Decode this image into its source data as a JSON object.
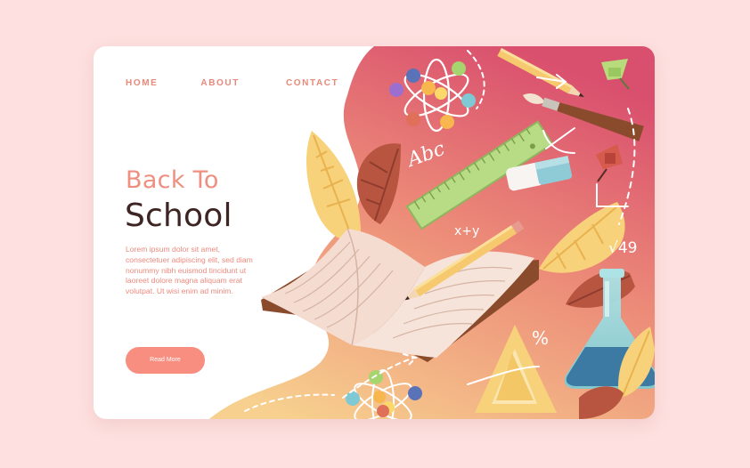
{
  "nav": {
    "home": "HOME",
    "about": "ABOUT",
    "contact": "CONTACT"
  },
  "hero": {
    "title_line1": "Back To",
    "title_line2": "School",
    "body": "Lorem ipsum dolor sit amet, consectetuer adipiscing elit, sed diam nonummy nibh euismod tincidunt ut laoreet dolore magna aliquam erat volutpat. Ut wisi enim ad minim.",
    "button_label": "Read More"
  },
  "illustration": {
    "abc_text": "Abc",
    "xy_text": "x+y",
    "sqrt_text": "√49",
    "percent_text": "%"
  },
  "colors": {
    "page_bg": "#fde0df",
    "accent": "#f78e7f",
    "title_dark": "#3e2523",
    "gradient_top": "#dc5a72",
    "gradient_bottom": "#f6c98a"
  }
}
